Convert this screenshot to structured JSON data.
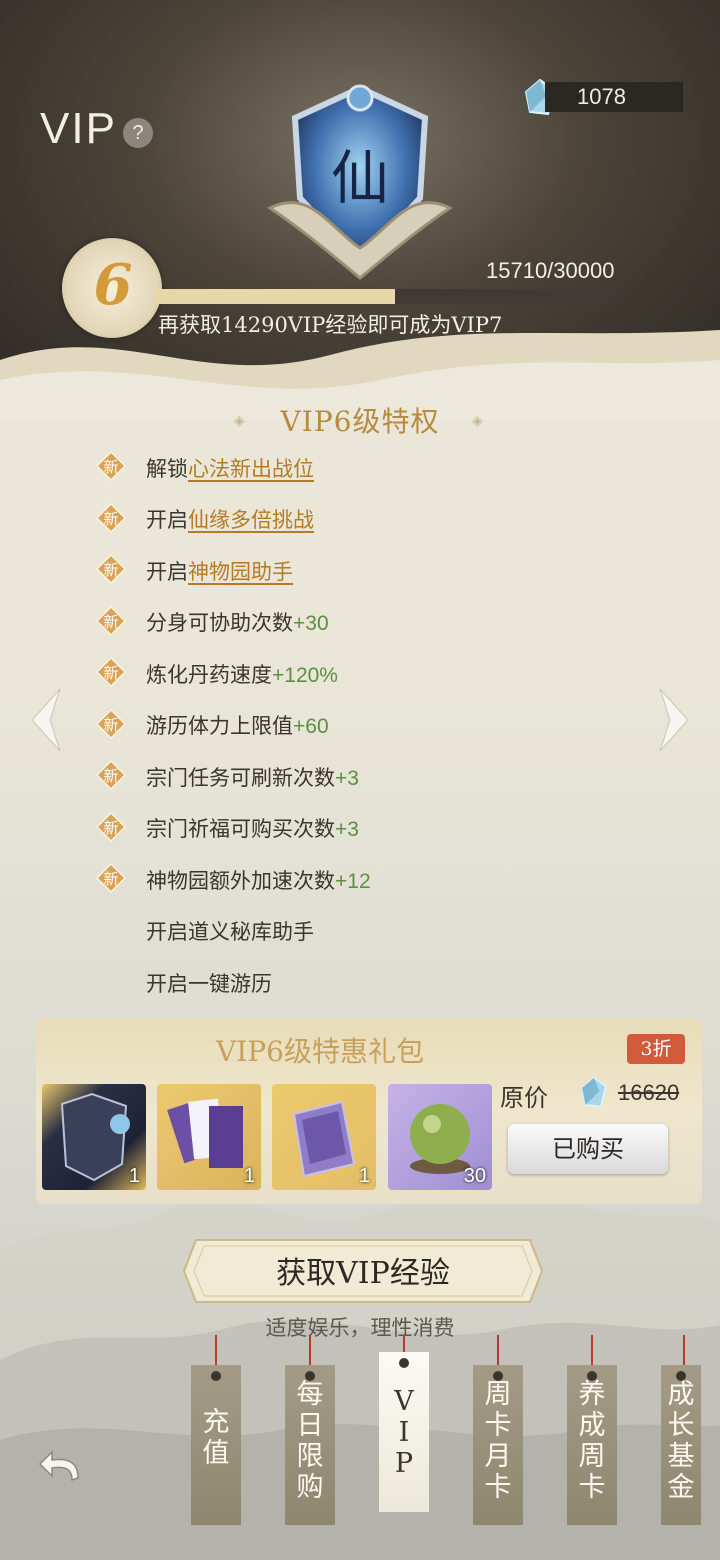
{
  "header": {
    "title": "VIP",
    "help": "?",
    "gems": "1078",
    "emblem_char": "仙"
  },
  "vip_level": {
    "level": "6",
    "exp_text": "15710/30000",
    "exp_fraction": 0.524,
    "hint": "再获取14290VIP经验即可成为VIP7"
  },
  "privileges": {
    "title": "VIP6级特权",
    "badge": "新",
    "items": [
      {
        "prefix": "解锁",
        "link": "心法新出战位",
        "plus": ""
      },
      {
        "prefix": "开启",
        "link": "仙缘多倍挑战",
        "plus": ""
      },
      {
        "prefix": "开启",
        "link": "神物园助手",
        "plus": ""
      },
      {
        "prefix": "分身可协助次数",
        "link": "",
        "plus": "+30"
      },
      {
        "prefix": "炼化丹药速度",
        "link": "",
        "plus": "+120%"
      },
      {
        "prefix": "游历体力上限值",
        "link": "",
        "plus": "+60"
      },
      {
        "prefix": "宗门任务可刷新次数",
        "link": "",
        "plus": "+3"
      },
      {
        "prefix": "宗门祈福可购买次数",
        "link": "",
        "plus": "+3"
      },
      {
        "prefix": "神物园额外加速次数",
        "link": "",
        "plus": "+12"
      },
      {
        "prefix": "开启道义秘库助手",
        "link": "",
        "plus": ""
      },
      {
        "prefix": "开启一键游历",
        "link": "",
        "plus": ""
      }
    ]
  },
  "gift_pack": {
    "title": "VIP6级特惠礼包",
    "discount": "3折",
    "items": [
      {
        "count": "1"
      },
      {
        "count": "1"
      },
      {
        "count": "1"
      },
      {
        "count": "30"
      }
    ],
    "orig_label": "原价",
    "orig_price": "16620",
    "button": "已购买"
  },
  "get_exp": {
    "label": "获取VIP经验",
    "moderate": "适度娱乐，理性消费"
  },
  "tabs": [
    {
      "label": "充值"
    },
    {
      "label": "每日限购"
    },
    {
      "label": "VIP"
    },
    {
      "label": "周卡月卡"
    },
    {
      "label": "养成周卡"
    },
    {
      "label": "成长基金"
    }
  ],
  "colors": {
    "accent_gold": "#b88a3c",
    "plus_green": "#5d8f42",
    "discount_red": "#d15a3a"
  }
}
